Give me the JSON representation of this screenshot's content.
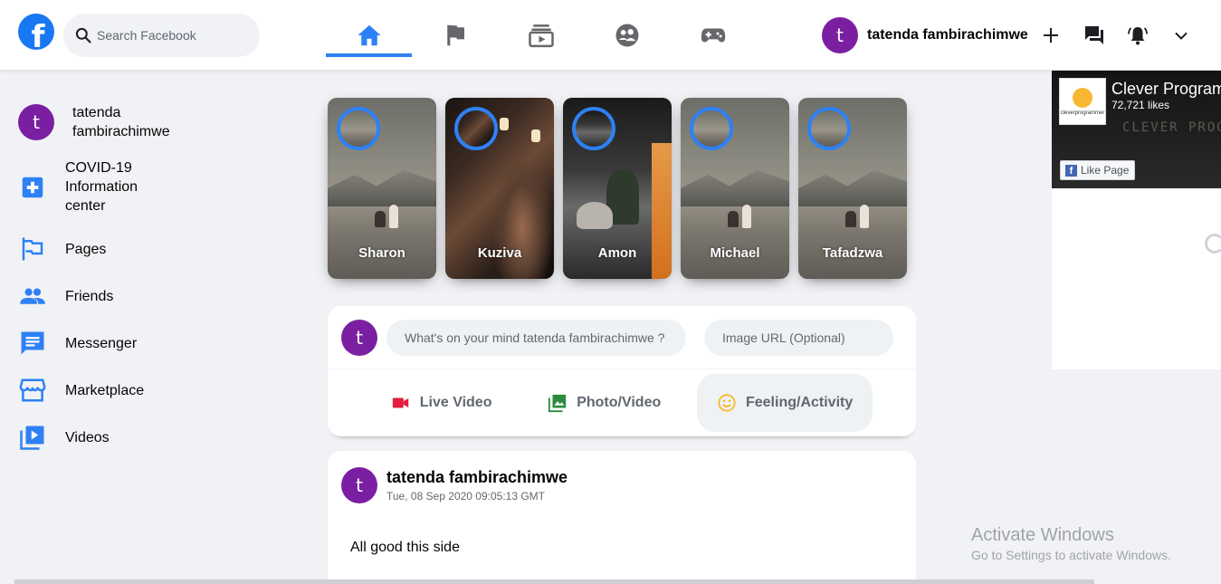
{
  "header": {
    "logo": "f",
    "search_placeholder": "Search Facebook",
    "nav": [
      "home-icon",
      "flag-icon",
      "subscriptions-icon",
      "supervised-user-icon",
      "gamepad-icon"
    ],
    "user_initial": "t",
    "user_name": "tatenda fambirachimwe",
    "accent_color": "#1877f2"
  },
  "sidebar": {
    "user": {
      "initial": "t",
      "name": "tatenda fambirachimwe"
    },
    "items": [
      {
        "label": "COVID-19 Information center",
        "icon": "local-hospital-icon"
      },
      {
        "label": "Pages",
        "icon": "emoji-flags-icon"
      },
      {
        "label": "Friends",
        "icon": "people-icon"
      },
      {
        "label": "Messenger",
        "icon": "chat-icon"
      },
      {
        "label": "Marketplace",
        "icon": "storefront-icon"
      },
      {
        "label": "Videos",
        "icon": "video-library-icon"
      }
    ]
  },
  "stories": [
    {
      "name": "Sharon"
    },
    {
      "name": "Kuziva"
    },
    {
      "name": "Amon"
    },
    {
      "name": "Michael"
    },
    {
      "name": "Tafadzwa"
    }
  ],
  "sender": {
    "avatar_initial": "t",
    "text_placeholder": "What's on your mind tatenda fambirachimwe ?",
    "image_placeholder": "Image URL (Optional)",
    "options": [
      {
        "label": "Live Video",
        "color": "#e41e3f"
      },
      {
        "label": "Photo/Video",
        "color": "#2b8a3e"
      },
      {
        "label": "Feeling/Activity",
        "color": "#f7b928"
      }
    ]
  },
  "post": {
    "avatar_initial": "t",
    "author": "tatenda fambirachimwe",
    "timestamp": "Tue, 08 Sep 2020 09:05:13 GMT",
    "message": "All good this side"
  },
  "widget": {
    "title": "Clever Programmer",
    "likes": "72,721 likes",
    "like_button": "Like Page",
    "cover_text": "CLEVER PROG",
    "brand": "cleverprogrammer"
  },
  "system": {
    "activate_title": "Activate Windows",
    "activate_sub": "Go to Settings to activate Windows."
  }
}
